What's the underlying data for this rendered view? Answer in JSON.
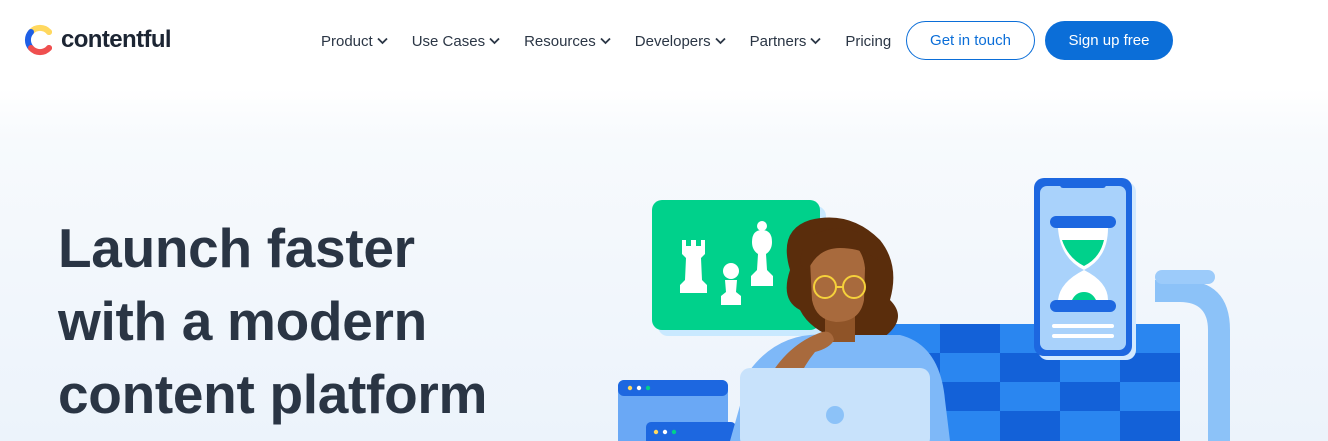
{
  "brand": {
    "name": "contentful",
    "logo_icon": "contentful-c-logo"
  },
  "nav": {
    "items": [
      {
        "label": "Product",
        "has_dropdown": true
      },
      {
        "label": "Use Cases",
        "has_dropdown": true
      },
      {
        "label": "Resources",
        "has_dropdown": true
      },
      {
        "label": "Developers",
        "has_dropdown": true
      },
      {
        "label": "Partners",
        "has_dropdown": true
      },
      {
        "label": "Pricing",
        "has_dropdown": false
      }
    ]
  },
  "cta": {
    "contact_label": "Get in touch",
    "signup_label": "Sign up free"
  },
  "hero": {
    "title_lines": [
      "Launch faster",
      "with a modern",
      "content platform"
    ]
  },
  "colors": {
    "accent": "#0b6ed8",
    "heading": "#2a3544",
    "chess_card": "#00d18b",
    "hair": "#5a2d0c",
    "skin": "#a86a3d",
    "checker_dark": "#1361d8",
    "checker_light": "#2a86f0"
  },
  "icons": [
    "chevron-down-icon",
    "chess-rook-icon",
    "chess-pawn-icon",
    "chess-bishop-icon",
    "hourglass-icon"
  ]
}
